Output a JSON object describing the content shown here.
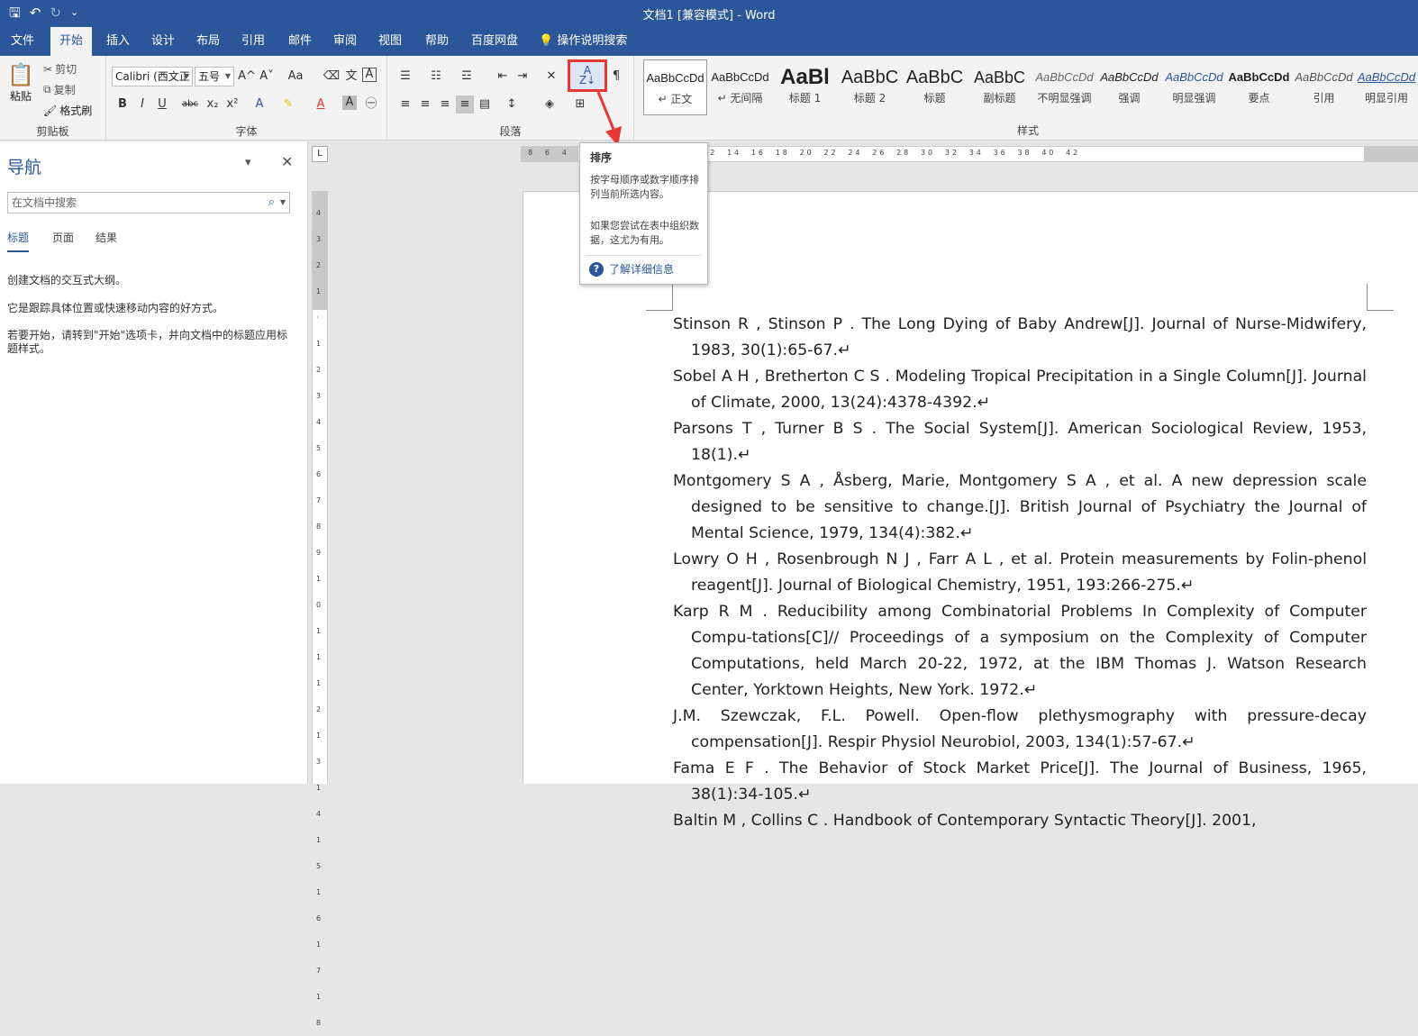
{
  "window": {
    "title": "文档1 [兼容模式] - Word"
  },
  "quick_access": {
    "save_icon": "save-icon",
    "undo_icon": "undo-icon",
    "redo_icon": "redo-icon",
    "customize_icon": "customize-qat-icon"
  },
  "tabs": [
    "文件",
    "开始",
    "插入",
    "设计",
    "布局",
    "引用",
    "邮件",
    "审阅",
    "视图",
    "帮助",
    "百度网盘"
  ],
  "tell_me": "操作说明搜索",
  "clipboard": {
    "paste": "粘贴",
    "cut": "剪切",
    "copy": "复制",
    "format_painter": "格式刷",
    "label": "剪贴板"
  },
  "font": {
    "name": "Calibri (西文正",
    "size": "五号",
    "label": "字体",
    "bold": "B",
    "italic": "I",
    "underline": "U",
    "strike": "abc",
    "sub": "x₂",
    "sup": "x²",
    "grow": "A^",
    "shrink": "A˅",
    "change_case": "Aa",
    "font_color_letter": "A"
  },
  "paragraph": {
    "label": "段落"
  },
  "styles": {
    "label": "样式",
    "items": [
      {
        "sample": "AaBbCcDd",
        "name": "↵ 正文"
      },
      {
        "sample": "AaBbCcDd",
        "name": "↵ 无间隔"
      },
      {
        "sample": "AaBl",
        "name": "标题 1"
      },
      {
        "sample": "AaBbC",
        "name": "标题 2"
      },
      {
        "sample": "AaBbC",
        "name": "标题"
      },
      {
        "sample": "AaBbC",
        "name": "副标题"
      },
      {
        "sample": "AaBbCcDd",
        "name": "不明显强调"
      },
      {
        "sample": "AaBbCcDd",
        "name": "强调"
      },
      {
        "sample": "AaBbCcDd",
        "name": "明显强调"
      },
      {
        "sample": "AaBbCcDd",
        "name": "要点"
      },
      {
        "sample": "AaBbCcDd",
        "name": "引用"
      },
      {
        "sample": "AaBbCcDd",
        "name": "明显引用"
      }
    ]
  },
  "nav_pane": {
    "title": "导航",
    "search_placeholder": "在文档中搜索",
    "tabs": [
      "标题",
      "页面",
      "结果"
    ],
    "messages": [
      "创建文档的交互式大纲。",
      "它是跟踪具体位置或快速移动内容的好方式。",
      "若要开始，请转到\"开始\"选项卡，并向文档中的标题应用标题样式。"
    ]
  },
  "tooltip": {
    "title": "排序",
    "text1": "按字母顺序或数字顺序排列当前所选内容。",
    "text2": "如果您尝试在表中组织数据，这尤为有用。",
    "link": "了解详细信息"
  },
  "document": {
    "references": [
      "Stinson R , Stinson P . The Long Dying of Baby Andrew[J]. Journal of Nurse-Midwifery, 1983, 30(1):65-67.↵",
      "Sobel A H , Bretherton C S . Modeling Tropical Precipitation in a Single Column[J]. Journal of Climate, 2000, 13(24):4378-4392.↵",
      "Parsons T , Turner B S . The Social System[J]. American Sociological Review, 1953, 18(1).↵",
      "Montgomery S A , Åsberg, Marie, Montgomery S A , et al. A new depression scale designed to be sensitive to change.[J]. British Journal of Psychiatry the Journal of Mental Science, 1979, 134(4):382.↵",
      "Lowry O H , Rosenbrough N J , Farr A L , et al. Protein measurements by Folin-phenol reagent[J]. Journal of Biological Chemistry, 1951, 193:266-275.↵",
      "Karp R M . Reducibility among Combinatorial Problems In Complexity of Computer Compu-tations[C]// Proceedings of a symposium on the Complexity of Computer Computations, held March 20-22, 1972, at the IBM Thomas J. Watson Research Center, Yorktown Heights, New York. 1972.↵",
      "J.M. Szewczak, F.L. Powell. Open-flow plethysmography with pressure-decay compensation[J]. Respir Physiol Neurobiol, 2003, 134(1):57-67.↵",
      "Fama E F . The Behavior of Stock Market Price[J]. The Journal of Business, 1965, 38(1):34-105.↵",
      "Baltin M , Collins C . Handbook of Contemporary Syntactic Theory[J]. 2001,"
    ]
  },
  "ruler": {
    "h_labels": "8  6  4  2     2  4  6  8  10  12  14  16  18  20  22  24  26  28  30  32  34  36  38  40  42",
    "v_labels": "4 3 2 1 · 1 2 3 4 5 6 7 8 9 10 11 12 13 14 15 16 17 18"
  },
  "colors": {
    "brand": "#2b579a",
    "highlight": "#e53935"
  }
}
